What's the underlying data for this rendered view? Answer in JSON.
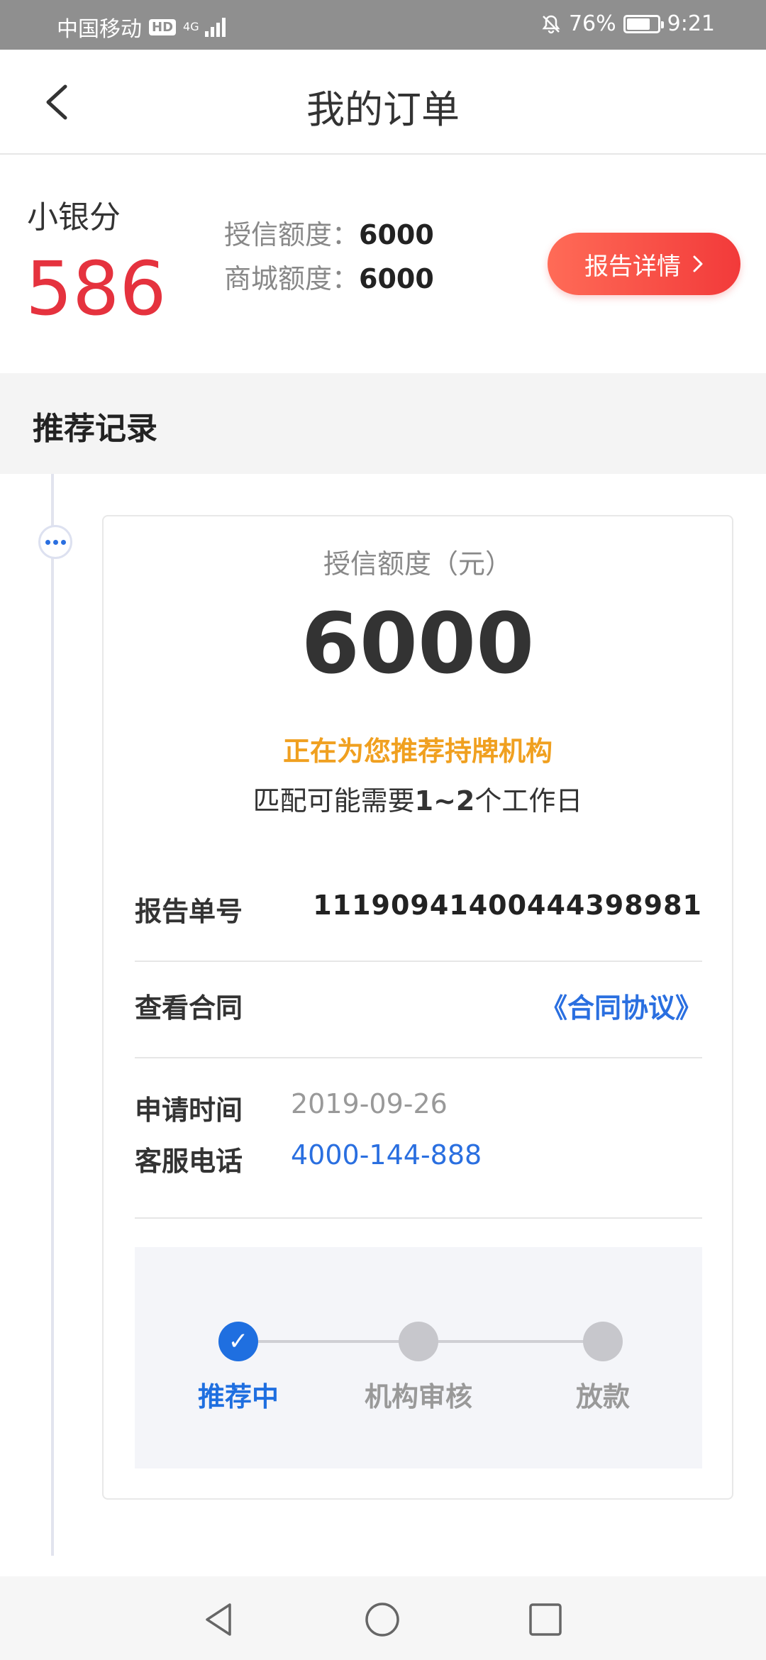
{
  "status_bar": {
    "carrier": "中国移动",
    "hd": "HD",
    "network": "4G",
    "battery": "76%",
    "battery_level": 0.76,
    "time": "9:21"
  },
  "nav": {
    "title": "我的订单"
  },
  "score": {
    "label": "小银分",
    "value": "586",
    "credit_label": "授信额度：",
    "credit_value": "6000",
    "mall_label": "商城额度：",
    "mall_value": "6000",
    "report_button": "报告详情"
  },
  "section": {
    "title": "推荐记录"
  },
  "card": {
    "amount_label": "授信额度（元）",
    "amount": "6000",
    "status": "正在为您推荐持牌机构",
    "note_prefix": "匹配可能需要",
    "note_days": "1~2",
    "note_suffix": "个工作日",
    "report_no_label": "报告单号",
    "report_no": "11190941400444398981",
    "contract_label": "查看合同",
    "contract_link": "《合同协议》",
    "apply_time_label": "申请时间",
    "apply_time": "2019-09-26",
    "service_phone_label": "客服电话",
    "service_phone": "4000-144-888",
    "steps": [
      {
        "label": "推荐中",
        "active": true,
        "check": "✓"
      },
      {
        "label": "机构审核",
        "active": false
      },
      {
        "label": "放款",
        "active": false
      }
    ]
  },
  "colors": {
    "accent_blue": "#1f6fe0",
    "score_red": "#e5323e",
    "status_orange": "#f0a020",
    "button_red": "#f23a3a"
  }
}
